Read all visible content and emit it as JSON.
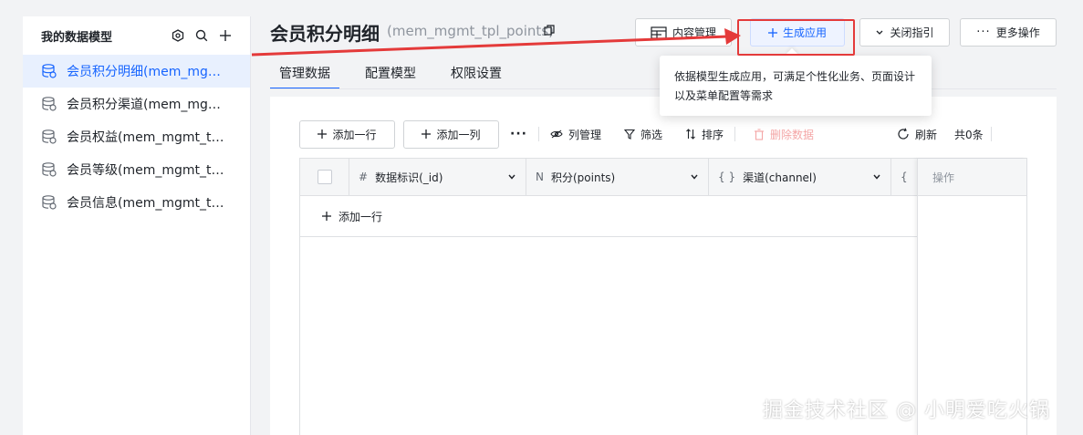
{
  "sidebar": {
    "title": "我的数据模型",
    "items": [
      {
        "label": "会员积分明细(mem_mgmt_tpl_points)",
        "active": true
      },
      {
        "label": "会员积分渠道(mem_mgmt_tpl_channel)"
      },
      {
        "label": "会员权益(mem_mgmt_tpl_benefit)"
      },
      {
        "label": "会员等级(mem_mgmt_tpl_level)"
      },
      {
        "label": "会员信息(mem_mgmt_tpl_info)"
      }
    ]
  },
  "header": {
    "title": "会员积分明细",
    "subtitle": "(mem_mgmt_tpl_points)",
    "buttons": {
      "content_mgmt": "内容管理",
      "generate_app": "生成应用",
      "close_guide": "关闭指引",
      "more_ops": "更多操作"
    }
  },
  "tabs": [
    "管理数据",
    "配置模型",
    "权限设置"
  ],
  "toolbar": {
    "add_row": "添加一行",
    "add_col": "添加一列",
    "col_mgmt": "列管理",
    "filter": "筛选",
    "sort": "排序",
    "delete": "删除数据",
    "refresh": "刷新",
    "count": "共0条"
  },
  "grid": {
    "columns": [
      {
        "type_icon": "#",
        "label": "数据标识(_id)"
      },
      {
        "type_icon": "N",
        "label": "积分(points)"
      },
      {
        "type_icon": "{ }",
        "label": "渠道(channel)"
      },
      {
        "type_icon": "{"
      }
    ],
    "ops_label": "操作",
    "add_row": "添加一行"
  },
  "tooltip": {
    "text": "依据模型生成应用，可满足个性化业务、页面设计以及菜单配置等需求"
  },
  "watermark": "掘金技术社区 @ 小明爱吃火锅",
  "colors": {
    "accent": "#1664ff",
    "annotation_red": "#e43a3a",
    "active_bg": "#e8f0fe"
  }
}
